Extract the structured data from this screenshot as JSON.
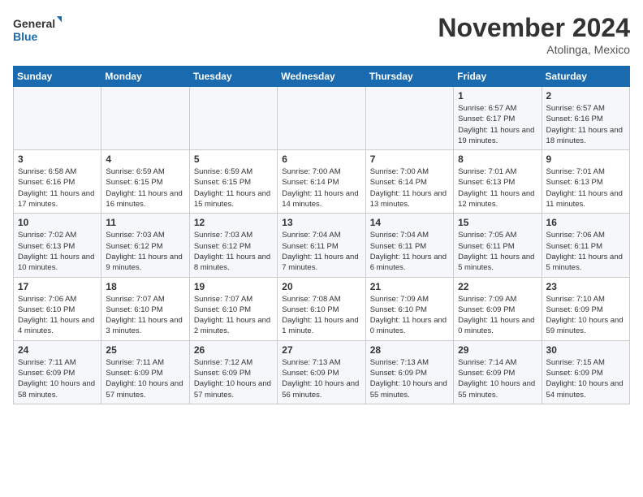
{
  "header": {
    "logo_line1": "General",
    "logo_line2": "Blue",
    "month_title": "November 2024",
    "location": "Atolinga, Mexico"
  },
  "days_of_week": [
    "Sunday",
    "Monday",
    "Tuesday",
    "Wednesday",
    "Thursday",
    "Friday",
    "Saturday"
  ],
  "weeks": [
    [
      {
        "day": "",
        "info": ""
      },
      {
        "day": "",
        "info": ""
      },
      {
        "day": "",
        "info": ""
      },
      {
        "day": "",
        "info": ""
      },
      {
        "day": "",
        "info": ""
      },
      {
        "day": "1",
        "info": "Sunrise: 6:57 AM\nSunset: 6:17 PM\nDaylight: 11 hours and 19 minutes."
      },
      {
        "day": "2",
        "info": "Sunrise: 6:57 AM\nSunset: 6:16 PM\nDaylight: 11 hours and 18 minutes."
      }
    ],
    [
      {
        "day": "3",
        "info": "Sunrise: 6:58 AM\nSunset: 6:16 PM\nDaylight: 11 hours and 17 minutes."
      },
      {
        "day": "4",
        "info": "Sunrise: 6:59 AM\nSunset: 6:15 PM\nDaylight: 11 hours and 16 minutes."
      },
      {
        "day": "5",
        "info": "Sunrise: 6:59 AM\nSunset: 6:15 PM\nDaylight: 11 hours and 15 minutes."
      },
      {
        "day": "6",
        "info": "Sunrise: 7:00 AM\nSunset: 6:14 PM\nDaylight: 11 hours and 14 minutes."
      },
      {
        "day": "7",
        "info": "Sunrise: 7:00 AM\nSunset: 6:14 PM\nDaylight: 11 hours and 13 minutes."
      },
      {
        "day": "8",
        "info": "Sunrise: 7:01 AM\nSunset: 6:13 PM\nDaylight: 11 hours and 12 minutes."
      },
      {
        "day": "9",
        "info": "Sunrise: 7:01 AM\nSunset: 6:13 PM\nDaylight: 11 hours and 11 minutes."
      }
    ],
    [
      {
        "day": "10",
        "info": "Sunrise: 7:02 AM\nSunset: 6:13 PM\nDaylight: 11 hours and 10 minutes."
      },
      {
        "day": "11",
        "info": "Sunrise: 7:03 AM\nSunset: 6:12 PM\nDaylight: 11 hours and 9 minutes."
      },
      {
        "day": "12",
        "info": "Sunrise: 7:03 AM\nSunset: 6:12 PM\nDaylight: 11 hours and 8 minutes."
      },
      {
        "day": "13",
        "info": "Sunrise: 7:04 AM\nSunset: 6:11 PM\nDaylight: 11 hours and 7 minutes."
      },
      {
        "day": "14",
        "info": "Sunrise: 7:04 AM\nSunset: 6:11 PM\nDaylight: 11 hours and 6 minutes."
      },
      {
        "day": "15",
        "info": "Sunrise: 7:05 AM\nSunset: 6:11 PM\nDaylight: 11 hours and 5 minutes."
      },
      {
        "day": "16",
        "info": "Sunrise: 7:06 AM\nSunset: 6:11 PM\nDaylight: 11 hours and 5 minutes."
      }
    ],
    [
      {
        "day": "17",
        "info": "Sunrise: 7:06 AM\nSunset: 6:10 PM\nDaylight: 11 hours and 4 minutes."
      },
      {
        "day": "18",
        "info": "Sunrise: 7:07 AM\nSunset: 6:10 PM\nDaylight: 11 hours and 3 minutes."
      },
      {
        "day": "19",
        "info": "Sunrise: 7:07 AM\nSunset: 6:10 PM\nDaylight: 11 hours and 2 minutes."
      },
      {
        "day": "20",
        "info": "Sunrise: 7:08 AM\nSunset: 6:10 PM\nDaylight: 11 hours and 1 minute."
      },
      {
        "day": "21",
        "info": "Sunrise: 7:09 AM\nSunset: 6:10 PM\nDaylight: 11 hours and 0 minutes."
      },
      {
        "day": "22",
        "info": "Sunrise: 7:09 AM\nSunset: 6:09 PM\nDaylight: 11 hours and 0 minutes."
      },
      {
        "day": "23",
        "info": "Sunrise: 7:10 AM\nSunset: 6:09 PM\nDaylight: 10 hours and 59 minutes."
      }
    ],
    [
      {
        "day": "24",
        "info": "Sunrise: 7:11 AM\nSunset: 6:09 PM\nDaylight: 10 hours and 58 minutes."
      },
      {
        "day": "25",
        "info": "Sunrise: 7:11 AM\nSunset: 6:09 PM\nDaylight: 10 hours and 57 minutes."
      },
      {
        "day": "26",
        "info": "Sunrise: 7:12 AM\nSunset: 6:09 PM\nDaylight: 10 hours and 57 minutes."
      },
      {
        "day": "27",
        "info": "Sunrise: 7:13 AM\nSunset: 6:09 PM\nDaylight: 10 hours and 56 minutes."
      },
      {
        "day": "28",
        "info": "Sunrise: 7:13 AM\nSunset: 6:09 PM\nDaylight: 10 hours and 55 minutes."
      },
      {
        "day": "29",
        "info": "Sunrise: 7:14 AM\nSunset: 6:09 PM\nDaylight: 10 hours and 55 minutes."
      },
      {
        "day": "30",
        "info": "Sunrise: 7:15 AM\nSunset: 6:09 PM\nDaylight: 10 hours and 54 minutes."
      }
    ]
  ]
}
